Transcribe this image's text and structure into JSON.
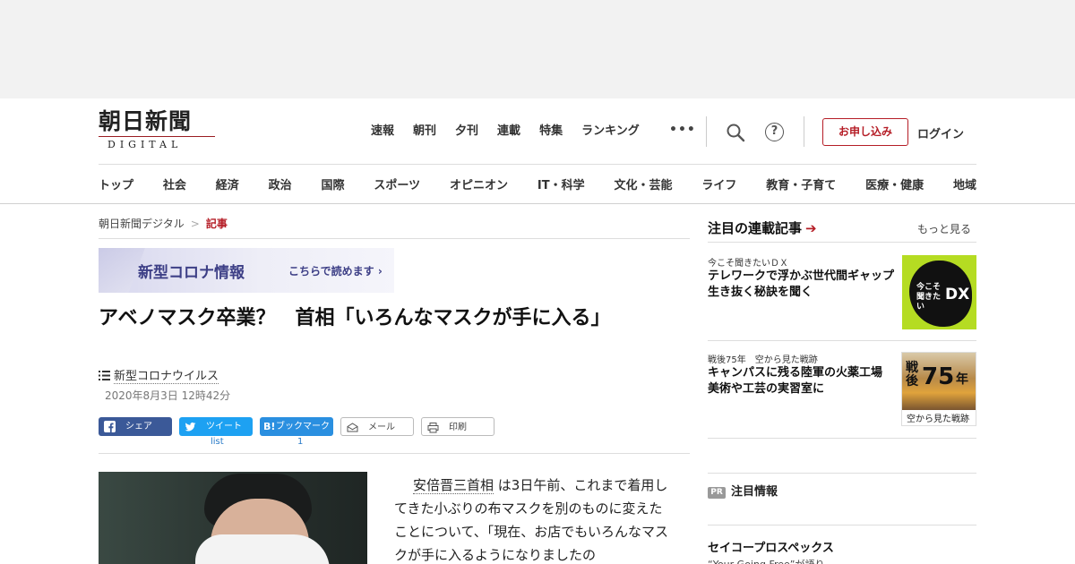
{
  "brand": {
    "logo_main": "朝日新聞",
    "logo_sub": "DIGITAL",
    "accent": "#b51d26"
  },
  "topnav": {
    "items": [
      "速報",
      "朝刊",
      "夕刊",
      "連載",
      "特集",
      "ランキング"
    ],
    "more": "•••"
  },
  "header": {
    "help": "?",
    "subscribe": "お申し込み",
    "login": "ログイン"
  },
  "catnav": {
    "items": [
      "トップ",
      "社会",
      "経済",
      "政治",
      "国際",
      "スポーツ",
      "オピニオン",
      "IT・科学",
      "文化・芸能",
      "ライフ",
      "教育・子育て",
      "医療・健康",
      "地域"
    ]
  },
  "breadcrumb": {
    "home": "朝日新聞デジタル",
    "sep": ">",
    "current": "記事"
  },
  "banner": {
    "title": "新型コロナ情報",
    "cta": "こちらで読めます ›"
  },
  "article": {
    "headline": "アベノマスク卒業？　首相「いろんなマスクが手に入る」",
    "tag": "新型コロナウイルス",
    "date": "2020年8月3日 12時42分",
    "body_name": "安倍晋三首相",
    "body_text": " は3日午前、これまで着用してきた小ぶりの布マスクを別のものに変えたことについて、「現在、お店でもいろんなマスクが手に入るようになりましたの"
  },
  "share": {
    "facebook": "シェア",
    "twitter": "ツイート",
    "twitter_count": "list",
    "hatena_icon": "B!",
    "hatena": "ブックマーク",
    "hatena_count": "1",
    "mail": "メール",
    "print": "印刷"
  },
  "sidebar": {
    "heading": "注目の連載記事",
    "arrow": "➔",
    "more": "もっと見る",
    "series": [
      {
        "kicker": "今こそ聞きたいＤＸ",
        "title": "テレワークで浮かぶ世代間ギャップ　生き抜く秘訣を聞く",
        "thumb_text_1": "今こそ聞きたい",
        "thumb_text_2": "DX"
      },
      {
        "kicker": "戦後75年　空から見た戦跡",
        "title": "キャンパスに残る陸軍の火薬工場　美術や工芸の実習室に",
        "thumb_text_1": "戦後",
        "thumb_text_2": "75",
        "thumb_text_3": "年",
        "thumb_caption": "空から見た戦跡"
      }
    ],
    "pr_badge": "PR",
    "pr_label": "注目情報",
    "sponsor": "セイコープロスペックス",
    "sponsor_sub": "“Your Going Free”が語り"
  },
  "colors": {
    "facebook": "#3b5998",
    "twitter": "#1da1f2",
    "hatena": "#2a8fe0",
    "dx_green": "#b5dc22"
  }
}
